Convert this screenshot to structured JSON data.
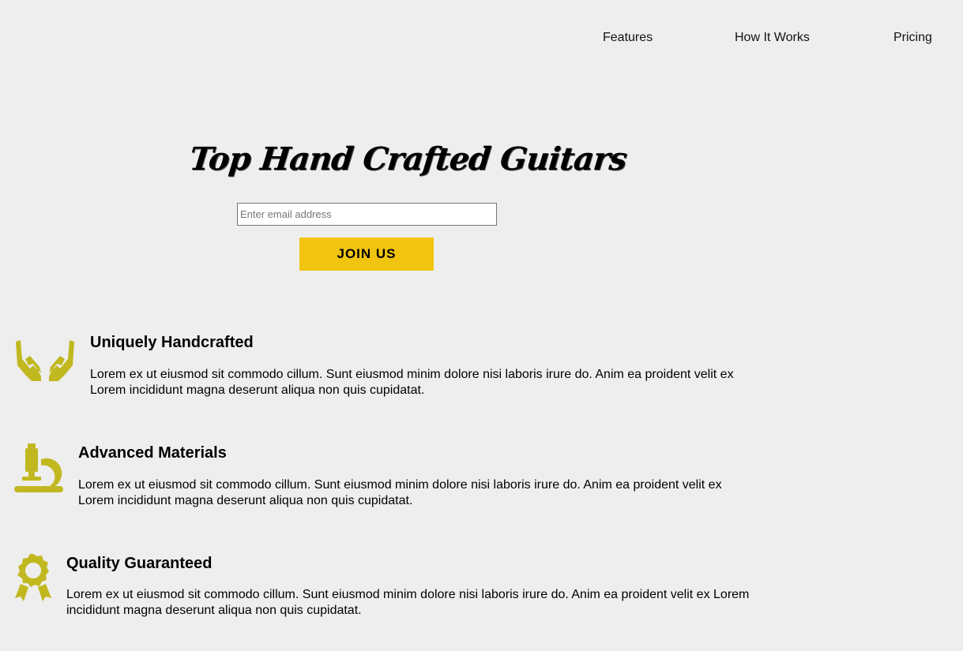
{
  "nav": {
    "features": "Features",
    "how_it_works": "How It Works",
    "pricing": "Pricing"
  },
  "hero": {
    "title": "Top Hand Crafted Guitars",
    "email_placeholder": "Enter email address",
    "join_label": "JOIN US"
  },
  "colors": {
    "accent": "#f1c40f",
    "icon": "#c1b820",
    "background": "#eeeeee"
  },
  "features": [
    {
      "icon": "hands-icon",
      "title": "Uniquely Handcrafted",
      "description": "Lorem ex ut eiusmod sit commodo cillum. Sunt eiusmod minim dolore nisi laboris irure do. Anim ea proident velit ex Lorem incididunt magna deserunt aliqua non quis cupidatat."
    },
    {
      "icon": "microscope-icon",
      "title": "Advanced Materials",
      "description": "Lorem ex ut eiusmod sit commodo cillum. Sunt eiusmod minim dolore nisi laboris irure do. Anim ea proident velit ex Lorem incididunt magna deserunt aliqua non quis cupidatat."
    },
    {
      "icon": "award-ribbon-icon",
      "title": "Quality Guaranteed",
      "description": "Lorem ex ut eiusmod sit commodo cillum. Sunt eiusmod minim dolore nisi laboris irure do. Anim ea proident velit ex Lorem incididunt magna deserunt aliqua non quis cupidatat."
    }
  ]
}
